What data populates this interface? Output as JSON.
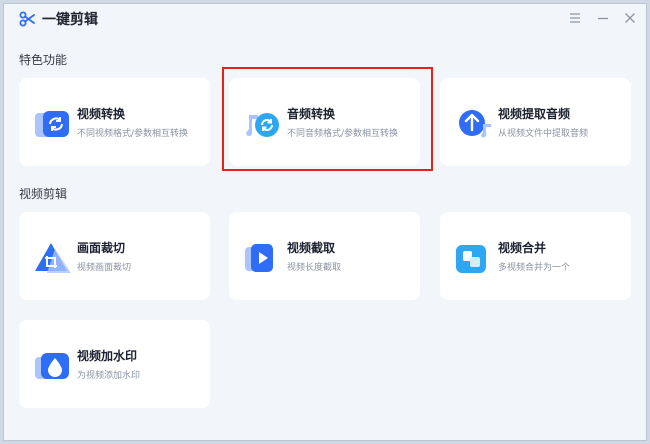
{
  "app": {
    "title": "一键剪辑",
    "accent": "#2f6df6"
  },
  "window_controls": [
    "menu-icon",
    "minimize-icon",
    "close-icon"
  ],
  "sections": {
    "featured": {
      "label": "特色功能",
      "cards": [
        {
          "title": "视频转换",
          "desc": "不同视频格式/参数相互转换",
          "icon": "video-convert-icon"
        },
        {
          "title": "音频转换",
          "desc": "不同音频格式/参数相互转换",
          "icon": "audio-convert-icon",
          "highlighted": true
        },
        {
          "title": "视频提取音频",
          "desc": "从视频文件中提取音频",
          "icon": "extract-audio-icon"
        }
      ]
    },
    "editing": {
      "label": "视频剪辑",
      "cards": [
        {
          "title": "画面裁切",
          "desc": "视频画面裁切",
          "icon": "crop-icon"
        },
        {
          "title": "视频截取",
          "desc": "视频长度截取",
          "icon": "video-trim-icon"
        },
        {
          "title": "视频合并",
          "desc": "多视频合并为一个",
          "icon": "merge-icon"
        },
        {
          "title": "视频加水印",
          "desc": "为视频添加水印",
          "icon": "watermark-icon"
        }
      ]
    }
  },
  "colors": {
    "highlight_border": "#e2231a",
    "card_bg": "#ffffff",
    "window_bg": "#f2f5f9"
  }
}
